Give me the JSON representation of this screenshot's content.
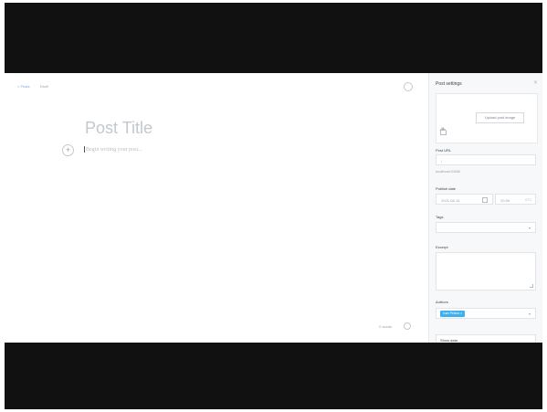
{
  "nav": {
    "back": "< Posts",
    "status": "Draft"
  },
  "editor": {
    "title_placeholder": "Post Title",
    "body_placeholder": "Begin writing your post...",
    "word_count": "0 words"
  },
  "sidebar": {
    "title": "Post settings",
    "upload_label": "Upload post image",
    "post_url_label": "Post URL",
    "post_url_value": "/",
    "post_url_hint": "localhost:2368/",
    "publish_date_label": "Publish date",
    "publish_date_value": "2021-06-14",
    "publish_time_value": "20:36",
    "timezone": "UTC",
    "tags_label": "Tags",
    "excerpt_label": "Excerpt",
    "authors_label": "Authors",
    "author_chip": "Ivan Petkov ×",
    "show_data_label": "Show data"
  },
  "icons": {
    "settings": "settings-toggle-icon",
    "add": "plus-icon",
    "help": "help-icon",
    "close": "close-icon",
    "home": "home-icon",
    "calendar": "calendar-icon",
    "chevron": "chevron-down-icon"
  }
}
